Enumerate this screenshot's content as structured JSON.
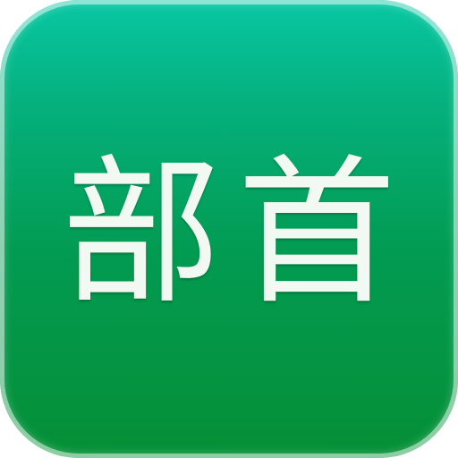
{
  "app_icon": {
    "characters": [
      "部",
      "首"
    ],
    "colors": {
      "gradient_top": "#08c7a3",
      "gradient_bottom": "#058f36",
      "text": "#f2f8f2"
    }
  }
}
